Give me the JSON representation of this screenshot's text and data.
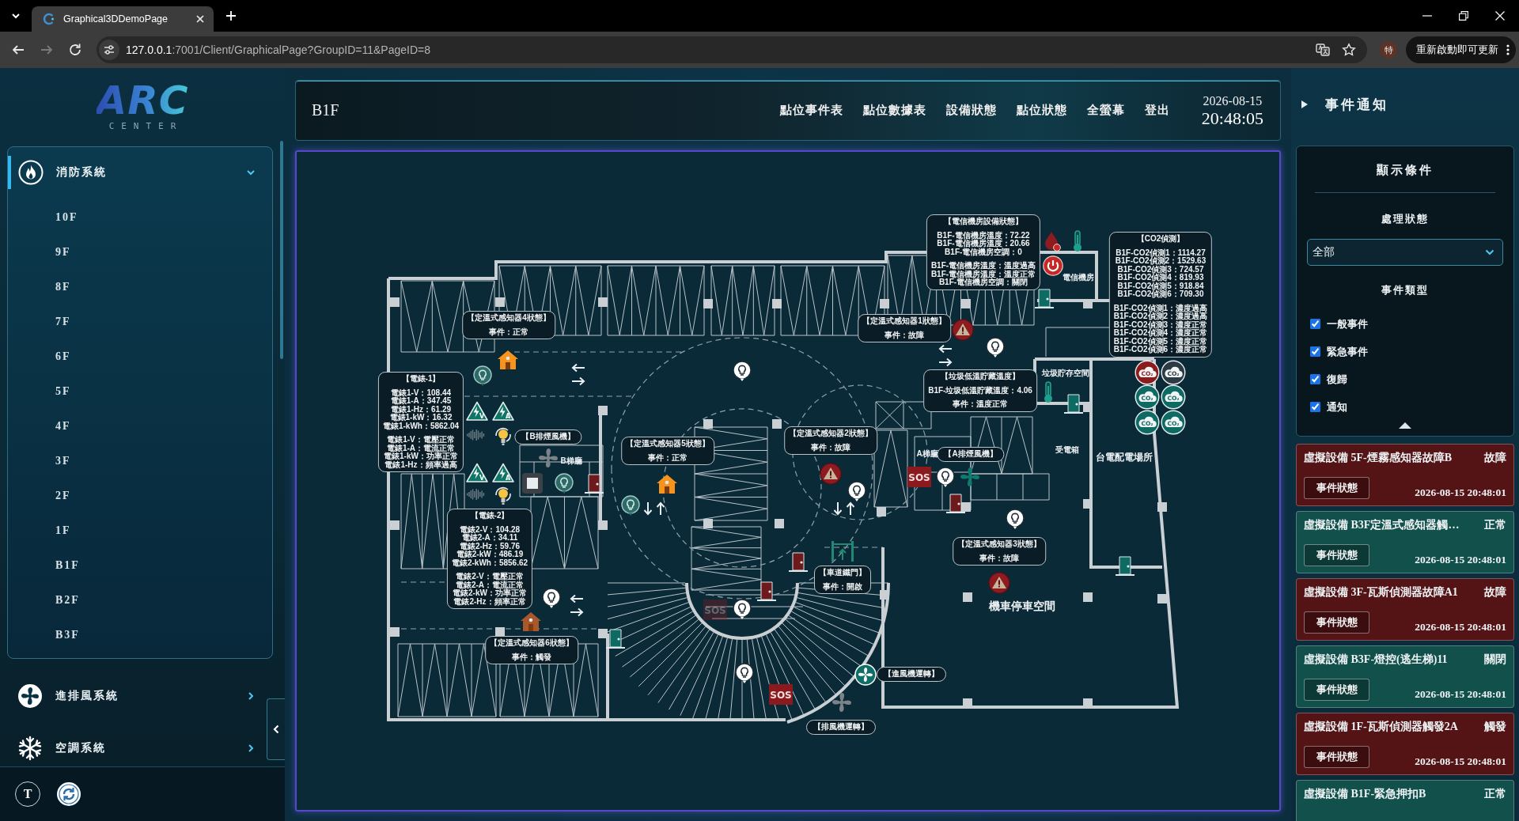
{
  "browser": {
    "tab": {
      "title": "Graphical3DDemoPage"
    },
    "address": {
      "host": "127.0.0.1",
      "path": ":7001/Client/GraphicalPage?GroupID=11&PageID=8"
    },
    "forward_disabled": true,
    "profile": "特",
    "update_button": "重新啟動即可更新"
  },
  "logo": {
    "wordmark": "ARC",
    "subtitle": "CENTER"
  },
  "sidebar": {
    "groups": [
      {
        "label": "消防系統",
        "selected": true,
        "expanded": true,
        "items": [
          "10F",
          "9F",
          "8F",
          "7F",
          "6F",
          "5F",
          "4F",
          "3F",
          "2F",
          "1F",
          "B1F",
          "B2F",
          "B3F"
        ]
      },
      {
        "label": "進排風系統",
        "selected": false,
        "expanded": false
      },
      {
        "label": "空調系統",
        "selected": false,
        "expanded": false
      }
    ],
    "footer_button": "T"
  },
  "header": {
    "floor": "B1F",
    "nav": [
      "點位事件表",
      "點位數據表",
      "設備狀態",
      "點位狀態",
      "全螢幕",
      "登出"
    ],
    "date": "2026-08-15",
    "time": "20:48:05"
  },
  "map": {
    "cards": [
      {
        "title": "【電信機房設備狀態】",
        "groups": [
          [
            "B1F-電信機房溫度：72.22",
            "B1F-電信機房溫度：20.66",
            "B1F-電信機房空調：0"
          ],
          [
            "B1F-電信機房溫度：溫度過高",
            "B1F-電信機房溫度：溫度正常",
            "B1F-電信機房空調：關閉"
          ]
        ]
      },
      {
        "title": "【CO2偵測】",
        "groups": [
          [
            "B1F-CO2偵測1：1114.27",
            "B1F-CO2偵測2：1529.63",
            "B1F-CO2偵測3：724.57",
            "B1F-CO2偵測4：819.93",
            "B1F-CO2偵測5：918.84",
            "B1F-CO2偵測6：709.30"
          ],
          [
            "B1F-CO2偵測1：濃度過高",
            "B1F-CO2偵測2：濃度過高",
            "B1F-CO2偵測3：濃度正常",
            "B1F-CO2偵測4：濃度正常",
            "B1F-CO2偵測5：濃度正常",
            "B1F-CO2偵測6：濃度正常"
          ]
        ]
      },
      {
        "title": "【定溫式感知器4狀態】",
        "groups": [
          [
            "事件：正常"
          ]
        ]
      },
      {
        "title": "【定溫式感知器1狀態】",
        "groups": [
          [
            "事件：故障"
          ]
        ]
      },
      {
        "title": "【電錶-1】",
        "groups": [
          [
            "電錶1-V：108.44",
            "電錶1-A：347.45",
            "電錶1-Hz：61.29",
            "電錶1-kW：16.32",
            "電錶1-kWh：5862.04"
          ],
          [
            "電錶1-V：電壓正常",
            "電錶1-A：電流正常",
            "電錶1-kW：功率正常",
            "電錶1-Hz：頻率過高"
          ]
        ]
      },
      {
        "title": "【垃圾低溫貯藏溫度】",
        "groups": [
          [
            "B1F-垃圾低溫貯藏溫度：4.06"
          ],
          [
            "事件：溫度正常"
          ]
        ]
      },
      {
        "title": "【B排煙風機】"
      },
      {
        "title": "【定溫式感知器5狀態】",
        "groups": [
          [
            "事件：正常"
          ]
        ]
      },
      {
        "title": "【定溫式感知器2狀態】",
        "groups": [
          [
            "事件：故障"
          ]
        ]
      },
      {
        "title": "【A排煙風機】"
      },
      {
        "title": "【電錶-2】",
        "groups": [
          [
            "電錶2-V：104.28",
            "電錶2-A：34.11",
            "電錶2-Hz：59.76",
            "電錶2-kW：486.19",
            "電錶2-kWh：5856.62"
          ],
          [
            "電錶2-V：電壓正常",
            "電錶2-A：電流正常",
            "電錶2-kW：功率正常",
            "電錶2-Hz：頻率正常"
          ]
        ]
      },
      {
        "title": "【車道鐵門】",
        "groups": [
          [
            "事件：開啟"
          ]
        ]
      },
      {
        "title": "【定溫式感知器3狀態】",
        "groups": [
          [
            "事件：故障"
          ]
        ]
      },
      {
        "title": "【定溫式感知器6狀態】",
        "groups": [
          [
            "事件：觸發"
          ]
        ]
      },
      {
        "title": "【進風機運轉】"
      },
      {
        "title": "【排風機運轉】"
      }
    ],
    "room_labels": [
      "電信機房",
      "垃圾貯存空間",
      "B梯廳",
      "A梯廳",
      "受電箱",
      "台電配電場所",
      "機車停車空間"
    ],
    "markers": [
      {
        "kind": "humidity"
      },
      {
        "kind": "thermometer"
      },
      {
        "kind": "power"
      },
      {
        "kind": "door",
        "color": "#0e6b63"
      },
      {
        "kind": "warning"
      },
      {
        "kind": "bulb",
        "on": true
      },
      {
        "kind": "left-arrow"
      },
      {
        "kind": "house",
        "color": "#f7941d"
      },
      {
        "kind": "right-arrow"
      },
      {
        "kind": "left-arrow"
      },
      {
        "kind": "bulb",
        "on": true
      },
      {
        "kind": "co2",
        "label": "CO₂",
        "color": "#8c1c1c"
      },
      {
        "kind": "co2",
        "label": "CO₂",
        "color": "#2c3a44"
      },
      {
        "kind": "bulb",
        "on": false
      },
      {
        "kind": "right-arrow"
      },
      {
        "kind": "thermometer"
      },
      {
        "kind": "co2",
        "label": "CO₂",
        "color": "#0e6b63"
      },
      {
        "kind": "co2",
        "label": "CO₂",
        "color": "#0e6b63"
      },
      {
        "kind": "door",
        "color": "#0e6b63"
      },
      {
        "kind": "voltage",
        "label": "V"
      },
      {
        "kind": "voltage",
        "label": "A"
      },
      {
        "kind": "co2",
        "label": "CO₂",
        "color": "#0e6b63"
      },
      {
        "kind": "co2",
        "label": "CO₂",
        "color": "#0e6b63"
      },
      {
        "kind": "sound-wave"
      },
      {
        "kind": "alarm-light"
      },
      {
        "kind": "fan",
        "color": "#7b8389"
      },
      {
        "kind": "voltage",
        "label": "V"
      },
      {
        "kind": "voltage",
        "label": "A"
      },
      {
        "kind": "warning"
      },
      {
        "kind": "sos",
        "label": "SOS",
        "faded": false
      },
      {
        "kind": "bulb",
        "on": true
      },
      {
        "kind": "fan",
        "color": "#0e7a70"
      },
      {
        "kind": "square-tile"
      },
      {
        "kind": "bulb",
        "on": false
      },
      {
        "kind": "door",
        "color": "#6e1a1c"
      },
      {
        "kind": "house",
        "color": "#f7941d"
      },
      {
        "kind": "bulb",
        "on": true
      },
      {
        "kind": "sound-wave"
      },
      {
        "kind": "alarm-light"
      },
      {
        "kind": "door",
        "color": "#6e1a1c"
      },
      {
        "kind": "bulb",
        "on": false
      },
      {
        "kind": "down-arrow"
      },
      {
        "kind": "up-arrow"
      },
      {
        "kind": "down-arrow"
      },
      {
        "kind": "up-arrow"
      },
      {
        "kind": "bulb",
        "on": true
      },
      {
        "kind": "gate"
      },
      {
        "kind": "door",
        "color": "#6e1a1c"
      },
      {
        "kind": "door",
        "color": "#0e6b63"
      },
      {
        "kind": "warning"
      },
      {
        "kind": "door",
        "color": "#6e1a1c"
      },
      {
        "kind": "bulb",
        "on": true
      },
      {
        "kind": "left-arrow"
      },
      {
        "kind": "bulb",
        "on": true
      },
      {
        "kind": "sos",
        "label": "SOS",
        "faded": true
      },
      {
        "kind": "right-arrow"
      },
      {
        "kind": "house",
        "color": "#a8582a"
      },
      {
        "kind": "door",
        "color": "#0e6b63"
      },
      {
        "kind": "bulb",
        "on": true
      },
      {
        "kind": "fan-badge"
      },
      {
        "kind": "sos",
        "label": "SOS",
        "faded": false
      },
      {
        "kind": "fan",
        "color": "#7b8389"
      }
    ]
  },
  "events_panel": {
    "title": "事件通知",
    "filter": {
      "title": "顯示條件",
      "status_label": "處理狀態",
      "status_value": "全部",
      "type_label": "事件類型",
      "types": [
        {
          "label": "一般事件",
          "checked": true
        },
        {
          "label": "緊急事件",
          "checked": true
        },
        {
          "label": "復歸",
          "checked": true
        },
        {
          "label": "通知",
          "checked": true
        }
      ],
      "expanded": true
    },
    "events": [
      {
        "title": "虛擬設備 5F-煙霧感知器故障B",
        "status": "故障",
        "button": "事件狀態",
        "time": "2026-08-15 20:48:01",
        "color": "#541315"
      },
      {
        "title": "虛擬設備 B3F定溫式感知器觸…",
        "status": "正常",
        "button": "事件狀態",
        "time": "2026-08-15 20:48:01",
        "color": "#11504b"
      },
      {
        "title": "虛擬設備 3F-瓦斯偵測器故障A1",
        "status": "故障",
        "button": "事件狀態",
        "time": "2026-08-15 20:48:01",
        "color": "#541315"
      },
      {
        "title": "虛擬設備 B3F-燈控(逃生梯)11",
        "status": "關閉",
        "button": "事件狀態",
        "time": "2026-08-15 20:48:01",
        "color": "#11504b"
      },
      {
        "title": "虛擬設備 1F-瓦斯偵測器觸發2A",
        "status": "觸發",
        "button": "事件狀態",
        "time": "2026-08-15 20:48:01",
        "color": "#541315"
      },
      {
        "title": "虛擬設備 B1F-緊急押扣B",
        "status": "正常",
        "color": "#11504b"
      }
    ]
  }
}
